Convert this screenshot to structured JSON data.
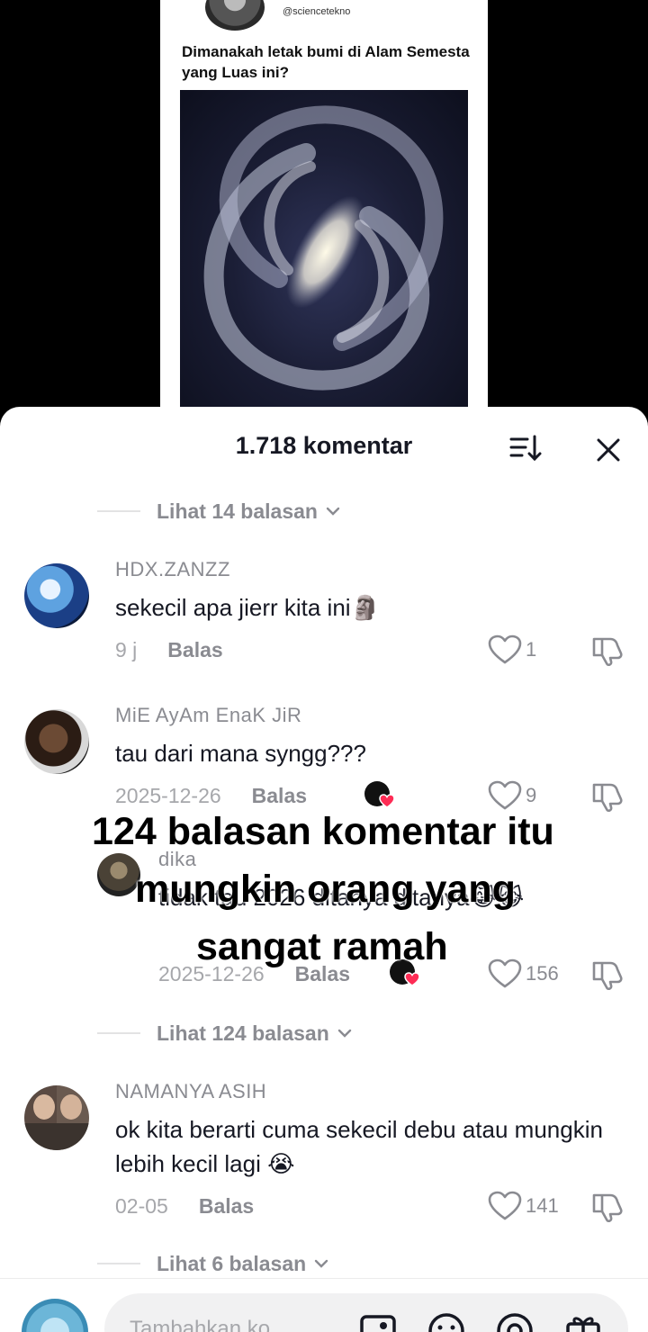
{
  "post": {
    "handle": "@sciencetekno",
    "question": "Dimanakah letak bumi di Alam Semesta yang Luas ini?"
  },
  "sheet": {
    "title": "1.718 komentar"
  },
  "replies_links": [
    {
      "label": "Lihat 14 balasan"
    },
    {
      "label": "Lihat 124 balasan"
    },
    {
      "label": "Lihat 6 balasan"
    }
  ],
  "reply_label": "Balas",
  "comments": [
    {
      "username": "HDX.ZANZZ",
      "text": "sekecil apa jierr kita ini🗿",
      "time": "9 j",
      "likes": "1"
    },
    {
      "username": "MiE AyAm EnaK JiR",
      "text": "tau dari mana syngg???",
      "time": "2025-12-26",
      "likes": "9"
    },
    {
      "username": "dika",
      "text": "tidak tau 2026 ditanya ditanya😹😹",
      "time": "2025-12-26",
      "likes": "156"
    },
    {
      "username": "NAMANYA ASIH",
      "text": "ok kita berarti cuma sekecil debu atau mungkin lebih kecil lagi 😭",
      "time": "02-05",
      "likes": "141"
    }
  ],
  "overlay_caption": {
    "line1": "124 balasan komentar itu",
    "line2": "mungkin orang yang",
    "line3": "sangat ramah"
  },
  "input": {
    "placeholder": "Tambahkan ko..."
  },
  "colors": {
    "like_heart": "#8a8b91",
    "creator_heart": "#fe2c55"
  }
}
